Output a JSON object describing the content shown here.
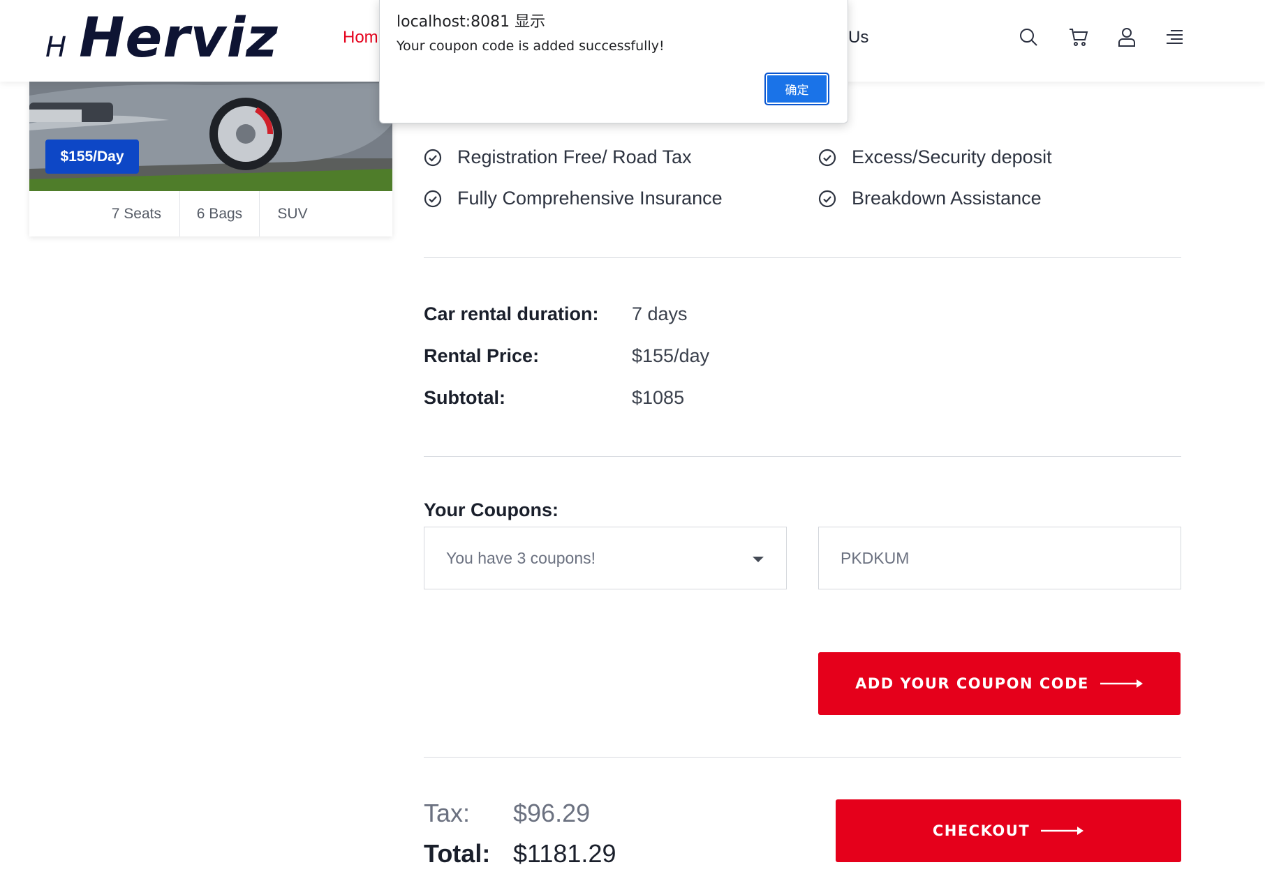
{
  "header": {
    "logo_mark": "H",
    "logo_text": "Herviz",
    "nav_home": "Hom",
    "nav_us": "Us",
    "icons": [
      "search-icon",
      "cart-icon",
      "user-icon",
      "menu-icon"
    ]
  },
  "car": {
    "price_badge": "$155/Day",
    "specs": [
      "7 Seats",
      "6 Bags",
      "SUV"
    ]
  },
  "features": [
    "Registration Free/ Road Tax",
    "Excess/Security deposit",
    "Fully Comprehensive Insurance",
    "Breakdown Assistance"
  ],
  "summary": {
    "duration_label": "Car rental duration:",
    "duration_value": "7 days",
    "price_label": "Rental Price:",
    "price_value": "$155/day",
    "subtotal_label": "Subtotal:",
    "subtotal_value": "$1085"
  },
  "coupons": {
    "label": "Your Coupons:",
    "select_value": "You have 3 coupons!",
    "code_value": "PKDKUM",
    "add_button": "ADD YOUR COUPON CODE"
  },
  "totals": {
    "tax_label": "Tax:",
    "tax_value": "$96.29",
    "total_label": "Total:",
    "total_value": "$1181.29",
    "checkout_button": "CHECKOUT"
  },
  "dialog": {
    "title": "localhost:8081 显示",
    "message": "Your coupon code is added successfully!",
    "ok_button": "确定"
  },
  "colors": {
    "accent_red": "#e5001b",
    "badge_blue": "#0d47c6",
    "dialog_blue": "#1a73e8"
  }
}
